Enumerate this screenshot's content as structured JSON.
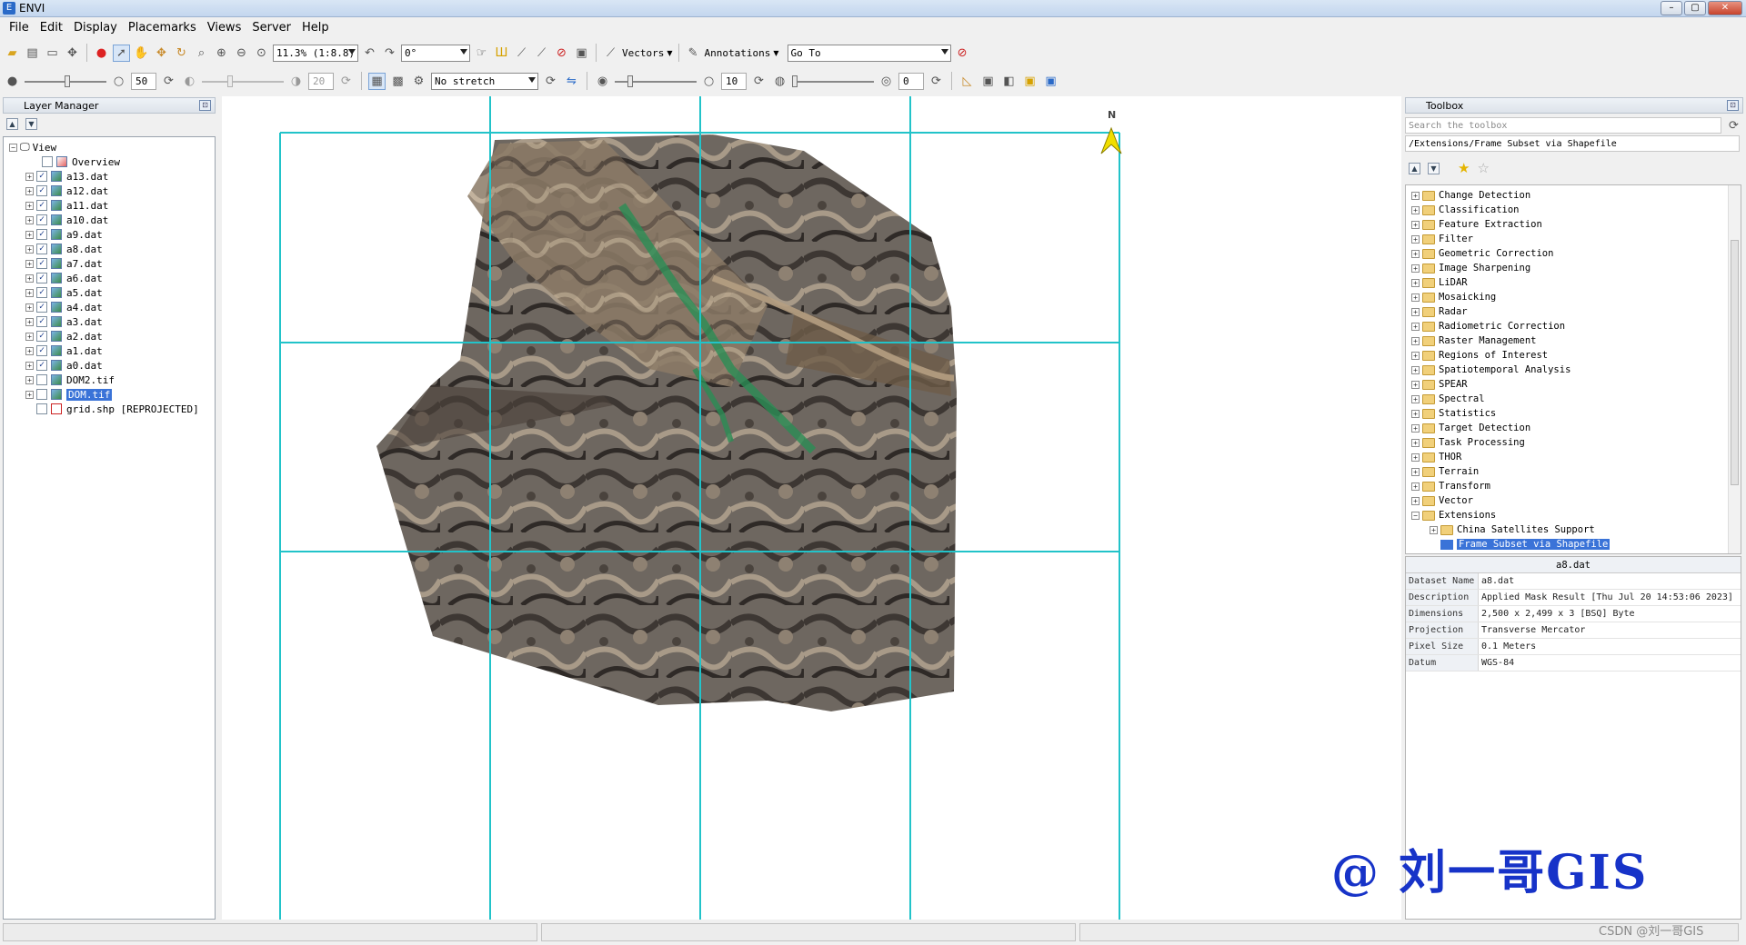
{
  "window": {
    "title": "ENVI"
  },
  "menu": [
    "File",
    "Edit",
    "Display",
    "Placemarks",
    "Views",
    "Server",
    "Help"
  ],
  "toolbar1": {
    "zoom_value": "11.3% (1:8.8)",
    "rotation_value": "0°",
    "vectors_label": "Vectors",
    "annotations_label": "Annotations",
    "goto_value": "Go To"
  },
  "toolbar2": {
    "brightness_value": "50",
    "contrast_value": "20",
    "stretch_value": "No stretch",
    "sharpen_value": "10",
    "transparency_value": "0"
  },
  "layer_manager": {
    "title": "Layer Manager",
    "view_label": "View",
    "overview_label": "Overview",
    "layers": [
      {
        "name": "a13.dat",
        "checked": true
      },
      {
        "name": "a12.dat",
        "checked": true
      },
      {
        "name": "a11.dat",
        "checked": true
      },
      {
        "name": "a10.dat",
        "checked": true
      },
      {
        "name": "a9.dat",
        "checked": true
      },
      {
        "name": "a8.dat",
        "checked": true
      },
      {
        "name": "a7.dat",
        "checked": true
      },
      {
        "name": "a6.dat",
        "checked": true
      },
      {
        "name": "a5.dat",
        "checked": true
      },
      {
        "name": "a4.dat",
        "checked": true
      },
      {
        "name": "a3.dat",
        "checked": true
      },
      {
        "name": "a2.dat",
        "checked": true
      },
      {
        "name": "a1.dat",
        "checked": true
      },
      {
        "name": "a0.dat",
        "checked": true
      },
      {
        "name": "DOM2.tif",
        "checked": false
      },
      {
        "name": "DOM.tif",
        "checked": false,
        "selected": true
      },
      {
        "name": "grid.shp [REPROJECTED]",
        "checked": false,
        "shapefile": true
      }
    ]
  },
  "view": {
    "north_label": "N"
  },
  "toolbox": {
    "title": "Toolbox",
    "search_placeholder": "Search the toolbox",
    "path": "/Extensions/Frame Subset via Shapefile",
    "folders": [
      "Change Detection",
      "Classification",
      "Feature Extraction",
      "Filter",
      "Geometric Correction",
      "Image Sharpening",
      "LiDAR",
      "Mosaicking",
      "Radar",
      "Radiometric Correction",
      "Raster Management",
      "Regions of Interest",
      "Spatiotemporal Analysis",
      "SPEAR",
      "Spectral",
      "Statistics",
      "Target Detection",
      "Task Processing",
      "THOR",
      "Terrain",
      "Transform",
      "Vector",
      "Extensions"
    ],
    "ext_children": [
      "China Satellites Support",
      "Frame Subset via Shapefile"
    ]
  },
  "properties": {
    "header": "a8.dat",
    "rows": [
      {
        "key": "Dataset Name",
        "value": "a8.dat"
      },
      {
        "key": "Description",
        "value": "Applied Mask Result [Thu Jul 20 14:53:06 2023]"
      },
      {
        "key": "Dimensions",
        "value": "2,500 x 2,499 x 3 [BSQ] Byte"
      },
      {
        "key": "Projection",
        "value": "Transverse Mercator"
      },
      {
        "key": "Pixel Size",
        "value": "0.1 Meters"
      },
      {
        "key": "Datum",
        "value": "WGS-84"
      }
    ]
  },
  "watermark": "@ 刘一哥GIS",
  "csdn_watermark": "CSDN @刘一哥GIS",
  "colors": {
    "grid": "#22c3c9",
    "selection": "#3a73d8",
    "watermark": "#1733c8"
  }
}
